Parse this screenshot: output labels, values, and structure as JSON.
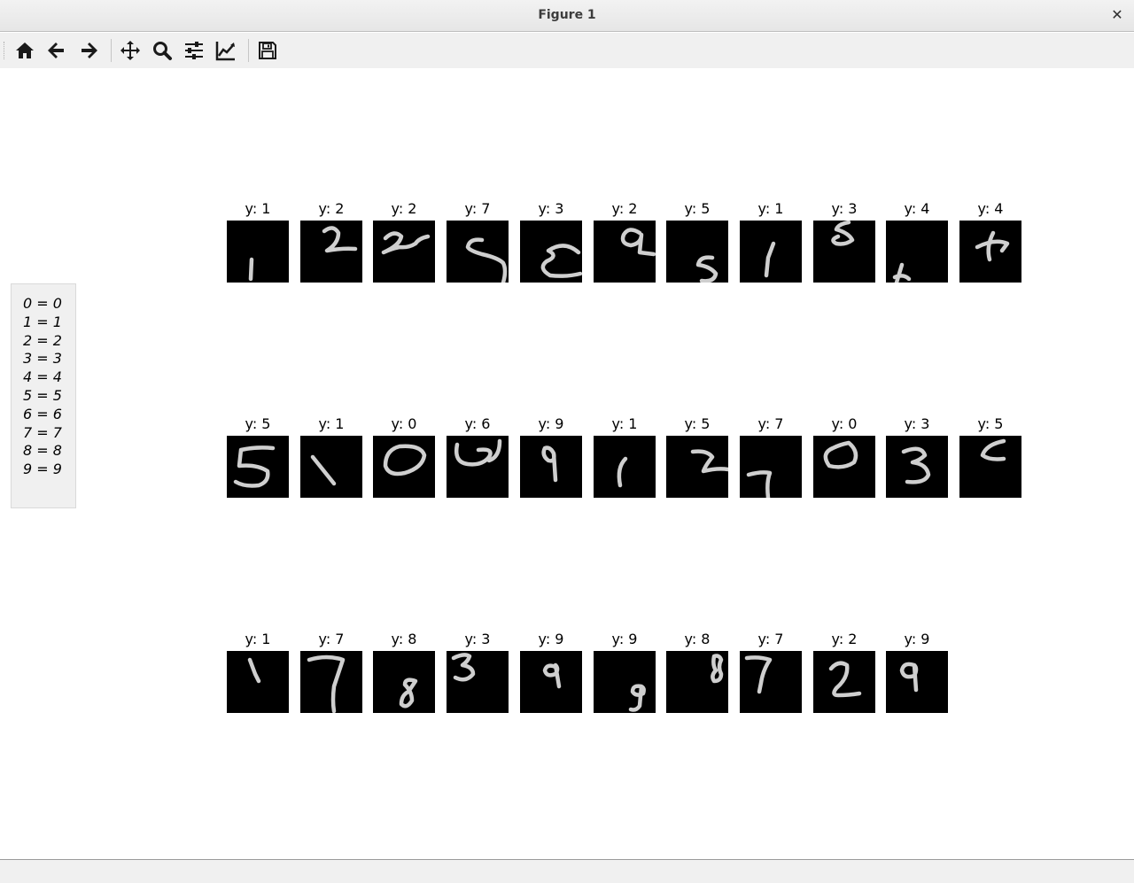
{
  "window": {
    "title": "Figure 1",
    "close_glyph": "✕"
  },
  "toolbar": {
    "buttons": [
      {
        "name": "home-icon",
        "label": "Home"
      },
      {
        "name": "back-arrow-icon",
        "label": "Back"
      },
      {
        "name": "forward-arrow-icon",
        "label": "Forward"
      },
      {
        "name": "pan-move-icon",
        "label": "Pan"
      },
      {
        "name": "zoom-magnifier-icon",
        "label": "Zoom"
      },
      {
        "name": "subplots-sliders-icon",
        "label": "Subplots"
      },
      {
        "name": "edit-axis-curve-icon",
        "label": "Customize"
      },
      {
        "name": "save-floppy-icon",
        "label": "Save"
      }
    ]
  },
  "legend": {
    "items": [
      "0 = 0",
      "1 = 1",
      "2 = 2",
      "3 = 3",
      "4 = 4",
      "5 = 5",
      "6 = 6",
      "7 = 7",
      "8 = 8",
      "9 = 9"
    ]
  },
  "colors": {
    "image_background": "#000000",
    "stroke": "#cfcfcf"
  },
  "grid": {
    "rows": [
      {
        "labels": [
          "y: 1",
          "y: 2",
          "y: 2",
          "y: 7",
          "y: 3",
          "y: 2",
          "y: 5",
          "y: 1",
          "y: 3",
          "y: 4",
          "y: 4"
        ]
      },
      {
        "labels": [
          "y: 5",
          "y: 1",
          "y: 0",
          "y: 6",
          "y: 9",
          "y: 1",
          "y: 5",
          "y: 7",
          "y: 0",
          "y: 3",
          "y: 5"
        ]
      },
      {
        "labels": [
          "y: 1",
          "y: 7",
          "y: 8",
          "y: 3",
          "y: 9",
          "y: 9",
          "y: 8",
          "y: 7",
          "y: 2",
          "y: 9"
        ]
      }
    ]
  }
}
